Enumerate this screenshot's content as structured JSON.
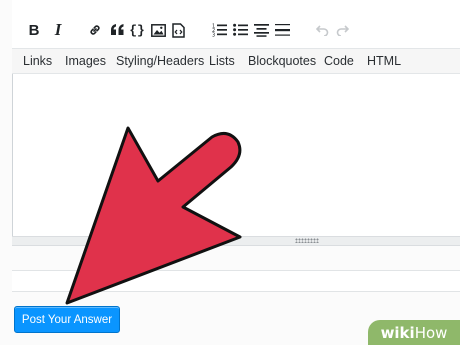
{
  "toolbar": {
    "buttons": [
      {
        "name": "bold",
        "glyph": "B"
      },
      {
        "name": "italic",
        "glyph": "I"
      },
      {
        "name": "link",
        "glyph": ""
      },
      {
        "name": "blockquote",
        "glyph": "66"
      },
      {
        "name": "code",
        "glyph": "{}"
      },
      {
        "name": "image",
        "glyph": ""
      },
      {
        "name": "snippet",
        "glyph": ""
      },
      {
        "name": "ordered-list",
        "glyph": ""
      },
      {
        "name": "unordered-list",
        "glyph": ""
      },
      {
        "name": "heading",
        "glyph": ""
      },
      {
        "name": "horizontal-rule",
        "glyph": ""
      },
      {
        "name": "undo",
        "glyph": ""
      },
      {
        "name": "redo",
        "glyph": ""
      }
    ]
  },
  "help_tabs": [
    "Links",
    "Images",
    "Styling/Headers",
    "Lists",
    "Blockquotes",
    "Code",
    "HTML"
  ],
  "editor": {
    "value": ""
  },
  "post_button": {
    "label": "Post Your Answer"
  },
  "watermark": {
    "brand": "wiki",
    "brand2": "How"
  },
  "colors": {
    "arrow_fill": "#e0324b",
    "arrow_stroke": "#111111",
    "button_blue": "#0a95ff",
    "watermark_green": "#8fb86a"
  }
}
